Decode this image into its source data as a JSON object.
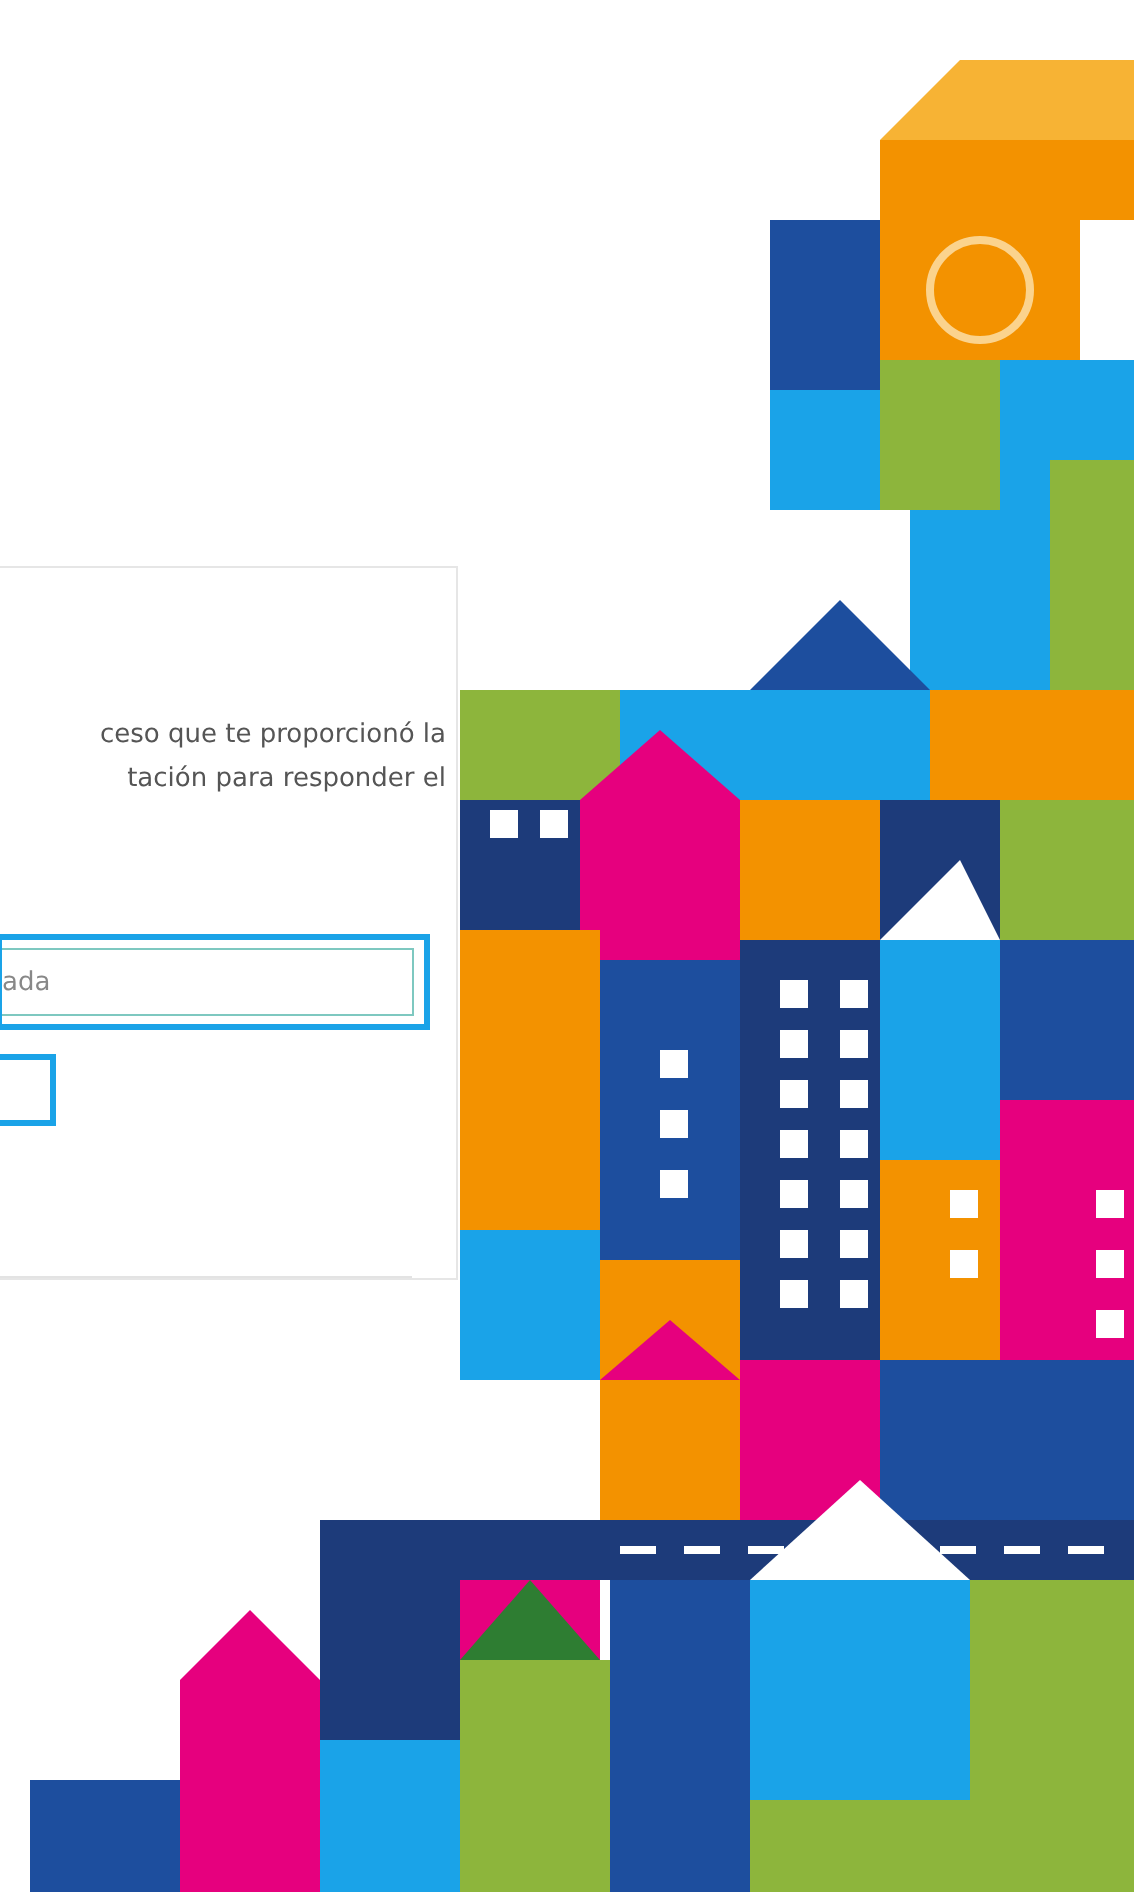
{
  "login_card": {
    "instructions_lines": [
      "ceso que te proporcionó la",
      "tación para responder el"
    ],
    "access_field": {
      "placeholder": "ada",
      "focused": true
    },
    "submit_button": {
      "focused": true
    }
  }
}
